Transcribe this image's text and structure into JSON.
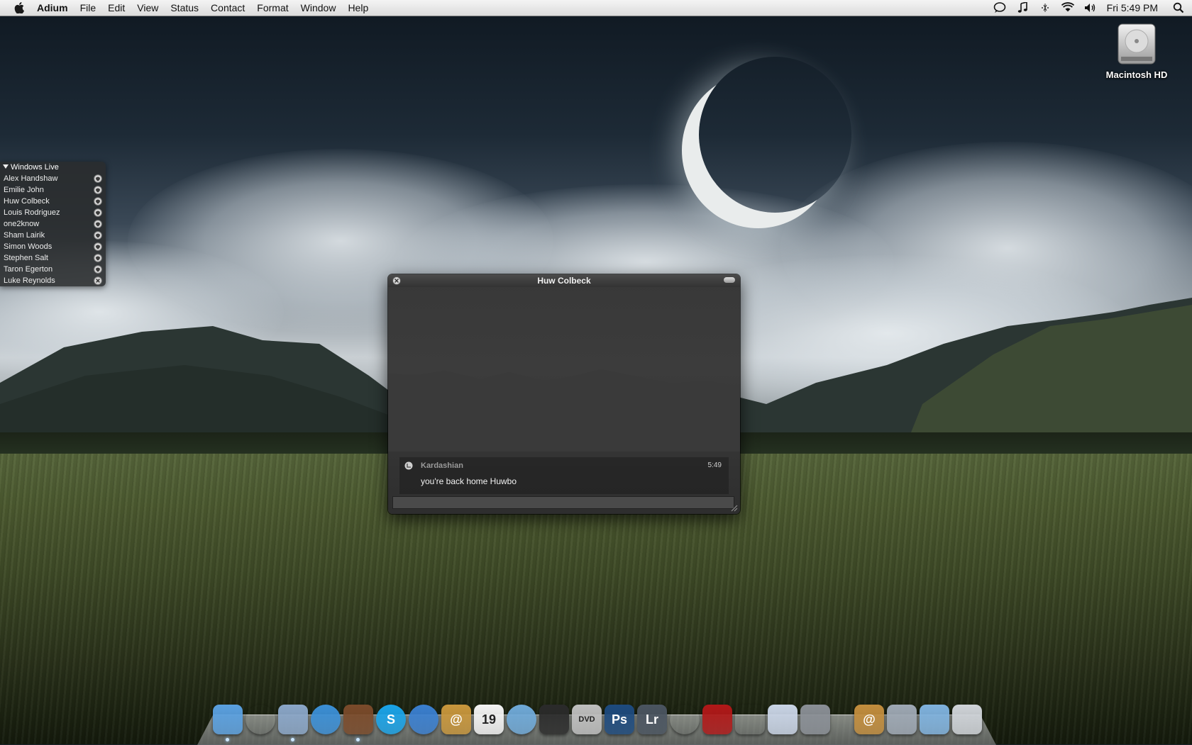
{
  "menubar": {
    "app_name": "Adium",
    "items": [
      "File",
      "Edit",
      "View",
      "Status",
      "Contact",
      "Format",
      "Window",
      "Help"
    ],
    "clock": "Fri 5:49 PM",
    "status_icons": [
      "adium-bubble-icon",
      "itunes-note-icon",
      "bluetooth-icon",
      "wifi-icon",
      "volume-icon",
      "spotlight-icon"
    ]
  },
  "desktop": {
    "hd_label": "Macintosh HD"
  },
  "contact_list": {
    "group": "Windows Live",
    "contacts": [
      {
        "name": "Alex Handshaw",
        "status": "available"
      },
      {
        "name": "Emilie John",
        "status": "available"
      },
      {
        "name": "Huw Colbeck",
        "status": "available"
      },
      {
        "name": "Louis Rodriguez",
        "status": "available"
      },
      {
        "name": "one2know",
        "status": "available"
      },
      {
        "name": "Sham Lairik",
        "status": "available"
      },
      {
        "name": "Simon Woods",
        "status": "available"
      },
      {
        "name": "Stephen Salt",
        "status": "available"
      },
      {
        "name": "Taron Egerton",
        "status": "available"
      },
      {
        "name": "Luke Reynolds",
        "status": "offline"
      }
    ]
  },
  "chat": {
    "title": "Huw Colbeck",
    "message": {
      "sender": "Kardashian",
      "time": "5:49",
      "text": "you're back home Huwbo"
    },
    "input_value": ""
  },
  "dock": {
    "apps": [
      {
        "name": "finder-icon",
        "label": "",
        "color": "#5aa0e0",
        "running": true
      },
      {
        "name": "dashboard-icon",
        "label": "",
        "color": "#333",
        "running": false
      },
      {
        "name": "mail-icon",
        "label": "",
        "color": "#8aa6c8",
        "running": true
      },
      {
        "name": "safari-icon",
        "label": "",
        "color": "#3b8fd6",
        "running": false
      },
      {
        "name": "domo-icon",
        "label": "",
        "color": "#7a4a2a",
        "running": true
      },
      {
        "name": "skype-icon",
        "label": "S",
        "color": "#1aa3e8",
        "running": false
      },
      {
        "name": "ichat-icon",
        "label": "",
        "color": "#3a7fd0",
        "running": false
      },
      {
        "name": "address-book-icon",
        "label": "@",
        "color": "#c8963c",
        "running": false
      },
      {
        "name": "ical-icon",
        "label": "19",
        "color": "#f4f4f4",
        "running": false
      },
      {
        "name": "itunes-icon",
        "label": "",
        "color": "#6fa9d8",
        "running": false
      },
      {
        "name": "itunes-dark-icon",
        "label": "",
        "color": "#2a2a2a",
        "running": false
      },
      {
        "name": "dvd-player-icon",
        "label": "DVD",
        "color": "#bfbfbf",
        "running": false
      },
      {
        "name": "photoshop-icon",
        "label": "Ps",
        "color": "#1d4a7e",
        "running": false
      },
      {
        "name": "lightroom-icon",
        "label": "Lr",
        "color": "#4a5460",
        "running": false
      },
      {
        "name": "aperture-icon",
        "label": "",
        "color": "#222",
        "running": false
      },
      {
        "name": "photo-booth-icon",
        "label": "",
        "color": "#b01818",
        "running": false
      },
      {
        "name": "script-editor-icon",
        "label": "",
        "color": "#556",
        "running": false
      },
      {
        "name": "textedit-icon",
        "label": "",
        "color": "#c9d4e6",
        "running": false
      },
      {
        "name": "system-preferences-icon",
        "label": "",
        "color": "#8a8f96",
        "running": false
      }
    ],
    "stacks": [
      {
        "name": "address-stack-icon",
        "label": "@",
        "color": "#c28d3d"
      },
      {
        "name": "preview-stack-icon",
        "label": "",
        "color": "#9ea8b4"
      },
      {
        "name": "downloads-folder-icon",
        "label": "",
        "color": "#7fb2de"
      },
      {
        "name": "trash-icon",
        "label": "",
        "color": "#cfd3d8"
      }
    ]
  }
}
